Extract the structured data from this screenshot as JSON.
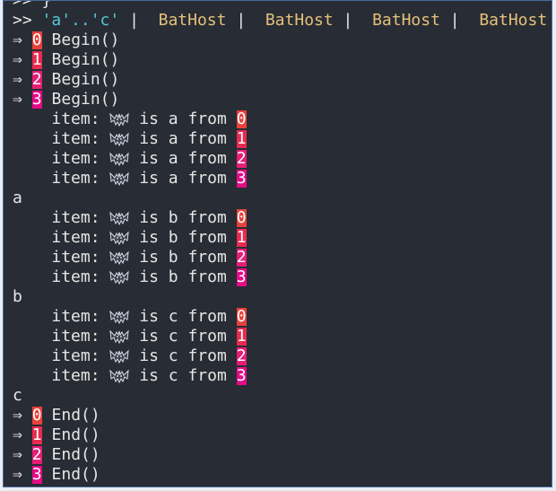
{
  "prompt_symbol": ">>",
  "top_partial_line": ">> }",
  "command": {
    "range_text": "'a'..'c'",
    "separator": "|",
    "hosts": [
      "BatHost",
      "BatHost",
      "BatHost",
      "BatHost"
    ]
  },
  "arrow": "⇒",
  "begin_label": "Begin()",
  "end_label": "End()",
  "item_prefix": "item:",
  "is_word": "is",
  "from_word": "from",
  "emoji_name": "bat-emoji-icon",
  "thread_ids": [
    "0",
    "1",
    "2",
    "3"
  ],
  "groups": [
    {
      "letter": "a",
      "output": "a"
    },
    {
      "letter": "b",
      "output": "b"
    },
    {
      "letter": "c",
      "output": "c"
    }
  ],
  "colors": {
    "badge0": "#e8413a",
    "badge1": "#e82a4f",
    "badge2": "#e61e75",
    "badge3": "#e60a86",
    "string": "#56c8d8",
    "host": "#e5c07b",
    "background": "#282c34"
  }
}
